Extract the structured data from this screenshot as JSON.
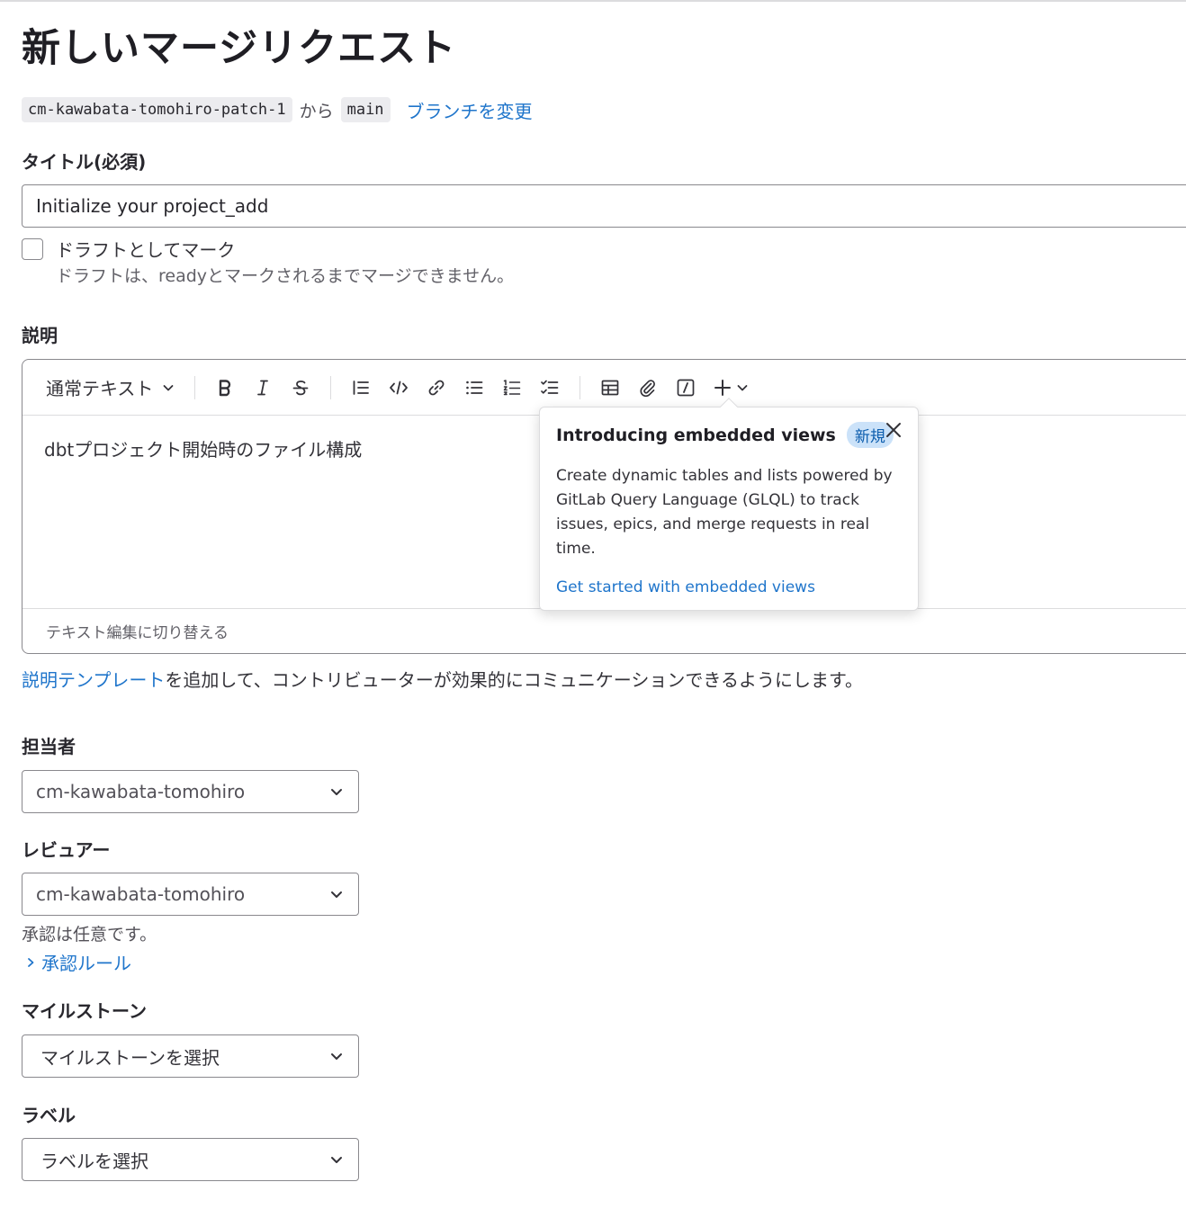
{
  "page": {
    "title": "新しいマージリクエスト"
  },
  "branches": {
    "source": "cm-kawabata-tomohiro-patch-1",
    "from_text": "から",
    "target": "main",
    "change_link": "ブランチを変更"
  },
  "title_field": {
    "label": "タイトル(必須)",
    "value": "Initialize your project_add"
  },
  "draft": {
    "label": "ドラフトとしてマーク",
    "help": "ドラフトは、readyとマークされるまでマージできません。",
    "checked": false
  },
  "description": {
    "label": "説明",
    "text_style": "通常テキスト",
    "toolbar_icons": [
      "bold-icon",
      "italic-icon",
      "strikethrough-icon",
      "blockquote-icon",
      "code-icon",
      "link-icon",
      "bullet-list-icon",
      "numbered-list-icon",
      "task-list-icon",
      "table-icon",
      "attachment-icon",
      "slash-command-icon",
      "plus-icon"
    ],
    "content": "dbtプロジェクト開始時のファイル構成",
    "footer_link": "テキスト編集に切り替える"
  },
  "popover": {
    "title": "Introducing embedded views",
    "badge": "新規",
    "body": "Create dynamic tables and lists powered by GitLab Query Language (GLQL) to track issues, epics, and merge requests in real time.",
    "link": "Get started with embedded views"
  },
  "template_hint": {
    "link": "説明テンプレート",
    "text": "を追加して、コントリビューターが効果的にコミュニケーションできるようにします。"
  },
  "assignee": {
    "label": "担当者",
    "value": "cm-kawabata-tomohiro"
  },
  "reviewer": {
    "label": "レビュアー",
    "value": "cm-kawabata-tomohiro",
    "optional_text": "承認は任意です。",
    "approval_rules_link": "承認ルール"
  },
  "milestone": {
    "label": "マイルストーン",
    "placeholder": "マイルストーンを選択"
  },
  "labels": {
    "label": "ラベル",
    "placeholder": "ラベルを選択"
  },
  "colors": {
    "link": "#1f75cb",
    "badge_bg": "#cbe2f9",
    "border": "#89888d"
  }
}
